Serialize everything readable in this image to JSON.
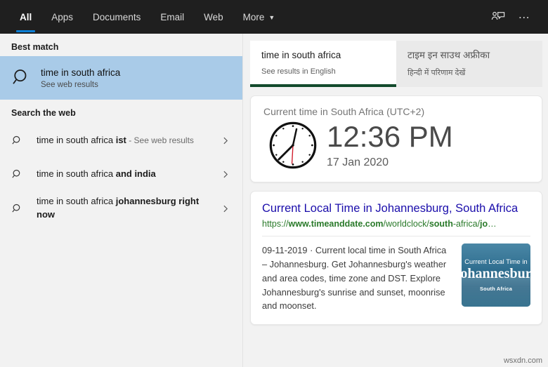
{
  "topbar": {
    "tabs": [
      {
        "label": "All",
        "active": true
      },
      {
        "label": "Apps",
        "active": false
      },
      {
        "label": "Documents",
        "active": false
      },
      {
        "label": "Email",
        "active": false
      },
      {
        "label": "Web",
        "active": false
      },
      {
        "label": "More",
        "active": false,
        "caret": "▼"
      }
    ],
    "feedback_icon": "feedback-person-icon",
    "overflow_label": "…",
    "accent_color": "#0c7fd6",
    "background_color": "#1f1f1f"
  },
  "sidebar": {
    "best_match_heading": "Best match",
    "best_match": {
      "title": "time in south africa",
      "subtitle": "See web results",
      "icon": "search-icon",
      "highlight_color": "#a9cbe8"
    },
    "search_web_heading": "Search the web",
    "suggestions": [
      {
        "prefix": "time in south africa ",
        "bold": "ist",
        "suffix": " - See web results",
        "icon": "search-icon",
        "chevron": "›"
      },
      {
        "prefix": "time in south africa ",
        "bold": "and india",
        "suffix": "",
        "icon": "search-icon",
        "chevron": "›"
      },
      {
        "prefix": "time in south africa ",
        "bold": "johannesburg right now",
        "suffix": "",
        "icon": "search-icon",
        "chevron": "›"
      }
    ]
  },
  "results": {
    "language_tabs": [
      {
        "main": "time in south africa",
        "sub": "See results in English",
        "active": true,
        "underline_color": "#134a2c"
      },
      {
        "main": "टाइम इन साउथ अफ्रीका",
        "sub": "हिन्दी में परिणाम देखें",
        "active": false
      }
    ],
    "time_card": {
      "title": "Current time in South Africa (UTC+2)",
      "time": "12:36 PM",
      "date": "17 Jan 2020",
      "clock_icon": "analog-clock-icon",
      "second_hand_color": "#d11a2a"
    },
    "web_result": {
      "title": "Current Local Time in Johannesburg, South Africa",
      "url_parts": [
        {
          "text": "https://",
          "bold": false
        },
        {
          "text": "www.timeanddate.com",
          "bold": true
        },
        {
          "text": "/worldclock/",
          "bold": false
        },
        {
          "text": "south",
          "bold": true
        },
        {
          "text": "-africa/",
          "bold": false
        },
        {
          "text": "jo",
          "bold": true
        },
        {
          "text": "…",
          "bold": false
        }
      ],
      "description": "09-11-2019 · Current local time in South Africa – Johannesburg. Get Johannesburg's weather and area codes, time zone and DST. Explore Johannesburg's sunrise and sunset, moonrise and moonset.",
      "thumbnail": {
        "line1": "Current Local Time in",
        "line2": "Johannesburg",
        "line3": "South Africa"
      },
      "link_color": "#1a0dab",
      "url_color": "#2a7a2a"
    }
  },
  "watermark": "wsxdn.com"
}
